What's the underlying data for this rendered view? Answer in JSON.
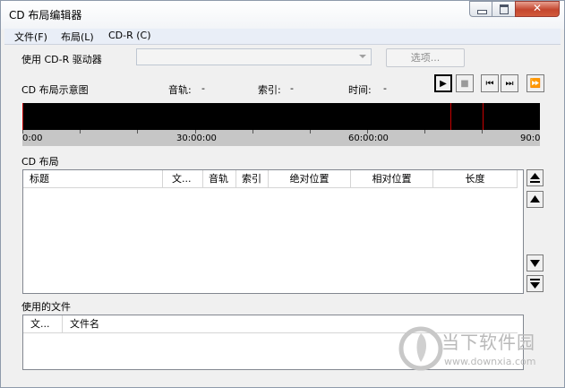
{
  "window": {
    "title": "CD 布局编辑器"
  },
  "menu": [
    "文件(F)",
    "布局(L)",
    "CD-R (C)"
  ],
  "drive": {
    "label": "使用 CD-R 驱动器",
    "options_button": "选项..."
  },
  "overview": {
    "label": "CD 布局示意图",
    "track_label": "音轨:",
    "track_value": "-",
    "index_label": "索引:",
    "index_value": "-",
    "time_label": "时间:",
    "time_value": "-"
  },
  "timeline": {
    "labels": [
      "0:00",
      "30:00:00",
      "60:00:00",
      "90:0"
    ]
  },
  "layout": {
    "label": "CD 布局",
    "columns": [
      "标题",
      "文...",
      "音轨",
      "索引",
      "绝对位置",
      "相对位置",
      "长度"
    ]
  },
  "files": {
    "label": "使用的文件",
    "columns": [
      "文...",
      "文件名"
    ]
  },
  "watermark": {
    "name": "当下软件园",
    "url": "www.downxia.com"
  },
  "colors": {
    "timeline_bg": "#000000",
    "marker": "#c80000",
    "menubar": "#e9eef7"
  }
}
